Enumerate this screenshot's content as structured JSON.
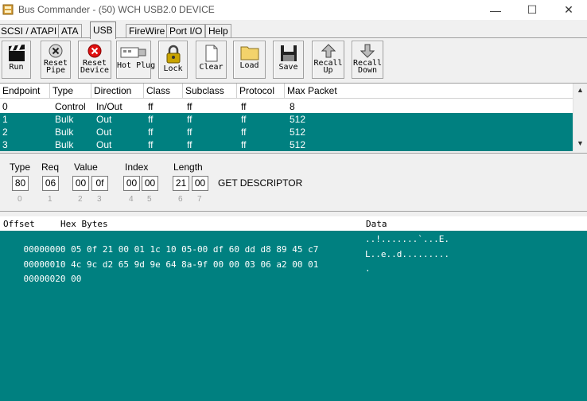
{
  "window": {
    "title": "Bus Commander - (50) WCH USB2.0 DEVICE",
    "minimize_glyph": "—",
    "maximize_glyph": "☐",
    "close_glyph": "✕"
  },
  "tabs": [
    {
      "label": "SCSI / ATAPI"
    },
    {
      "label": "ATA"
    },
    {
      "label": "USB"
    },
    {
      "label": "FireWire"
    },
    {
      "label": "Port I/O"
    },
    {
      "label": "Help"
    }
  ],
  "toolbar": {
    "run": "Run",
    "reset_pipe": "Reset\nPipe",
    "reset_device": "Reset\nDevice",
    "hot_plug": "Hot Plug",
    "lock": "Lock",
    "clear": "Clear",
    "load": "Load",
    "save": "Save",
    "recall_up": "Recall\nUp",
    "recall_down": "Recall\nDown"
  },
  "endpoints": {
    "headers": [
      "Endpoint",
      "Type",
      "Direction",
      "Class",
      "Subclass",
      "Protocol",
      "Max Packet"
    ],
    "rows": [
      [
        "0",
        "Control",
        "In/Out",
        "ff",
        "ff",
        "ff",
        "8"
      ],
      [
        "1",
        "Bulk",
        "Out",
        "ff",
        "ff",
        "ff",
        "512"
      ],
      [
        "2",
        "Bulk",
        "Out",
        "ff",
        "ff",
        "ff",
        "512"
      ],
      [
        "3",
        "Bulk",
        "Out",
        "ff",
        "ff",
        "ff",
        "512"
      ]
    ],
    "scroll_up": "▲",
    "scroll_down": "▼"
  },
  "setup": {
    "labels": {
      "type": "Type",
      "req": "Req",
      "value": "Value",
      "index": "Index",
      "length": "Length"
    },
    "bytes": [
      "80",
      "06",
      "00",
      "0f",
      "00",
      "00",
      "21",
      "00"
    ],
    "indices": [
      "0",
      "1",
      "2",
      "3",
      "4",
      "5",
      "6",
      "7"
    ],
    "request_name": "GET DESCRIPTOR"
  },
  "hex": {
    "offset_header": "Offset",
    "bytes_header": "Hex Bytes",
    "data_header": "Data",
    "lines": [
      {
        "offset": "00000000",
        "hex": "05 0f 21 00 01 1c 10 05-00 df 60 dd d8 89 45 c7",
        "ascii": "..!.......`...E."
      },
      {
        "offset": "00000010",
        "hex": "4c 9c d2 65 9d 9e 64 8a-9f 00 00 03 06 a2 00 01",
        "ascii": "L..e..d........."
      },
      {
        "offset": "00000020",
        "hex": "00",
        "ascii": "."
      }
    ]
  },
  "colors": {
    "selection": "#008080",
    "hex_background": "#008080"
  }
}
